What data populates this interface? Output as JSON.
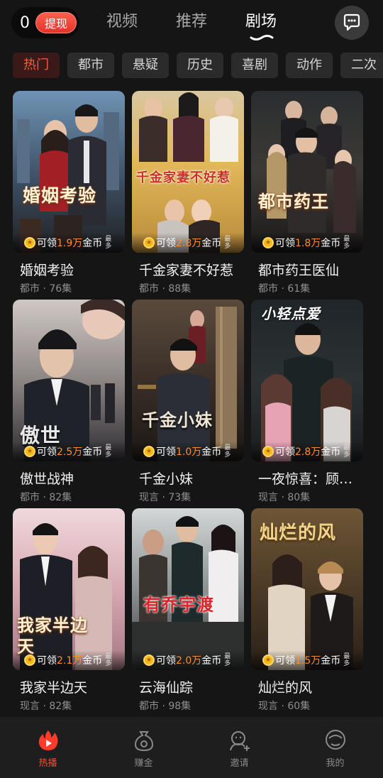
{
  "header": {
    "coin_count": "0",
    "withdraw_label": "提现",
    "tabs": [
      {
        "label": "视频",
        "active": false
      },
      {
        "label": "推荐",
        "active": false
      },
      {
        "label": "剧场",
        "active": true
      }
    ],
    "message_icon": "chat-bubble-icon"
  },
  "categories": [
    "热门",
    "都市",
    "悬疑",
    "历史",
    "喜剧",
    "动作",
    "二次"
  ],
  "active_category": "热门",
  "reward_prefix": "可领",
  "reward_suffix": "金币",
  "reward_most": "最多",
  "dramas": [
    {
      "title": "婚姻考验",
      "genre": "都市",
      "episodes": "76集",
      "reward": "1.9万",
      "poster_text": "婚姻考验"
    },
    {
      "title": "千金家妻不好惹",
      "genre": "都市",
      "episodes": "88集",
      "reward": "2.8万",
      "poster_text": "千金家妻不好惹"
    },
    {
      "title": "都市药王医仙",
      "genre": "都市",
      "episodes": "61集",
      "reward": "1.8万",
      "poster_text": "都市药王"
    },
    {
      "title": "傲世战神",
      "genre": "都市",
      "episodes": "82集",
      "reward": "2.5万",
      "poster_text": "傲世"
    },
    {
      "title": "千金小妹",
      "genre": "现言",
      "episodes": "73集",
      "reward": "1.0万",
      "poster_text": "千金小妹"
    },
    {
      "title": "一夜惊喜：顾…",
      "genre": "现言",
      "episodes": "80集",
      "reward": "2.8万",
      "poster_text": "小轻点爱"
    },
    {
      "title": "我家半边天",
      "genre": "现言",
      "episodes": "82集",
      "reward": "2.1万",
      "poster_text": "我家半边天"
    },
    {
      "title": "云海仙踪",
      "genre": "都市",
      "episodes": "98集",
      "reward": "2.0万",
      "poster_text": "有乔宇渡"
    },
    {
      "title": "灿烂的风",
      "genre": "现言",
      "episodes": "60集",
      "reward": "1.5万",
      "poster_text": "灿烂的风"
    }
  ],
  "bottom_nav": [
    {
      "label": "热播",
      "icon": "flame-play-icon",
      "active": true
    },
    {
      "label": "赚金",
      "icon": "money-bag-icon",
      "active": false
    },
    {
      "label": "邀请",
      "icon": "invite-user-icon",
      "active": false
    },
    {
      "label": "我的",
      "icon": "profile-icon",
      "active": false
    }
  ],
  "colors": {
    "background": "#151515",
    "accent": "#ff4a2e",
    "reward_amount": "#ff8c2e",
    "chip_bg": "#2b2b2b"
  }
}
